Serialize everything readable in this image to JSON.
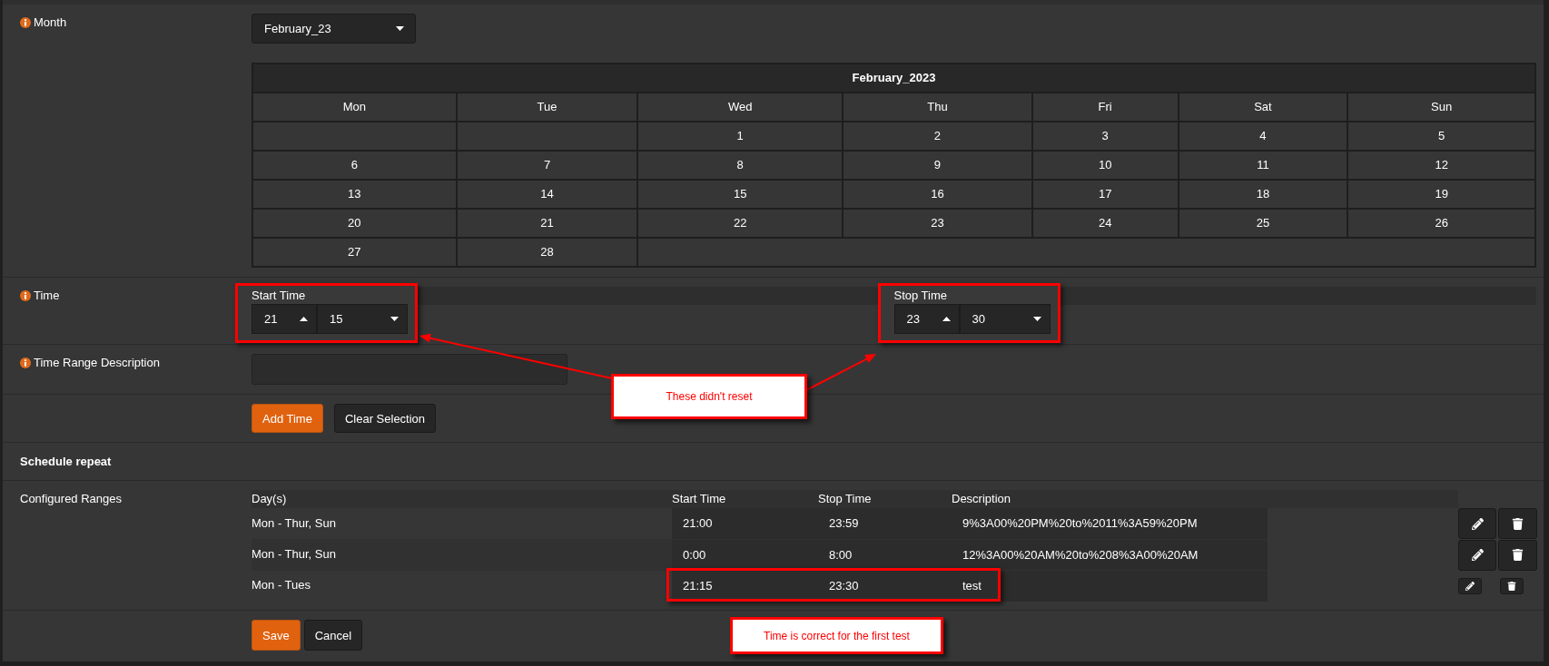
{
  "month": {
    "label": "Month",
    "info": true,
    "value": "February_23"
  },
  "calendar": {
    "title": "February_2023",
    "weekdays": [
      "Mon",
      "Tue",
      "Wed",
      "Thu",
      "Fri",
      "Sat",
      "Sun"
    ],
    "weeks": [
      {
        "kind": "first",
        "days": [
          "1",
          "2",
          "3",
          "4",
          "5"
        ]
      },
      {
        "kind": "full",
        "days": [
          "6",
          "7",
          "8",
          "9",
          "10",
          "11",
          "12"
        ]
      },
      {
        "kind": "full",
        "days": [
          "13",
          "14",
          "15",
          "16",
          "17",
          "18",
          "19"
        ]
      },
      {
        "kind": "full",
        "days": [
          "20",
          "21",
          "22",
          "23",
          "24",
          "25",
          "26"
        ]
      },
      {
        "kind": "last",
        "days": [
          "27",
          "28"
        ]
      }
    ]
  },
  "time": {
    "label": "Time",
    "info": true,
    "start": {
      "label": "Start Time",
      "hour": "21",
      "minute": "15",
      "highlighted": true
    },
    "stop": {
      "label": "Stop Time",
      "hour": "23",
      "minute": "30",
      "highlighted": true
    }
  },
  "description": {
    "label": "Time Range Description",
    "info": true
  },
  "time_actions": [
    {
      "label": "Add Time",
      "kind": "primary"
    },
    {
      "label": "Clear Selection",
      "kind": "default"
    }
  ],
  "section": {
    "title": "Schedule repeat"
  },
  "ranges": {
    "label": "Configured Ranges",
    "info": false,
    "columns": [
      "Day(s)",
      "Start Time",
      "Stop Time",
      "Description"
    ],
    "rows": [
      {
        "days": "Mon - Thur, Sun",
        "start": "21:00",
        "stop": "23:59",
        "description": "9%3A00%20PM%20to%2011%3A59%20PM",
        "compact_actions": false,
        "highlighted": false
      },
      {
        "days": "Mon - Thur, Sun",
        "start": "0:00",
        "stop": "8:00",
        "description": "12%3A00%20AM%20to%208%3A00%20AM",
        "compact_actions": false,
        "highlighted": false
      },
      {
        "days": "Mon - Tues",
        "start": "21:15",
        "stop": "23:30",
        "description": "test",
        "compact_actions": true,
        "highlighted": true
      }
    ]
  },
  "form_actions": [
    {
      "label": "Save",
      "kind": "primary"
    },
    {
      "label": "Cancel",
      "kind": "default"
    }
  ],
  "annotations": [
    {
      "text": "These didn't reset"
    },
    {
      "text": "Time is correct for the first test"
    }
  ]
}
